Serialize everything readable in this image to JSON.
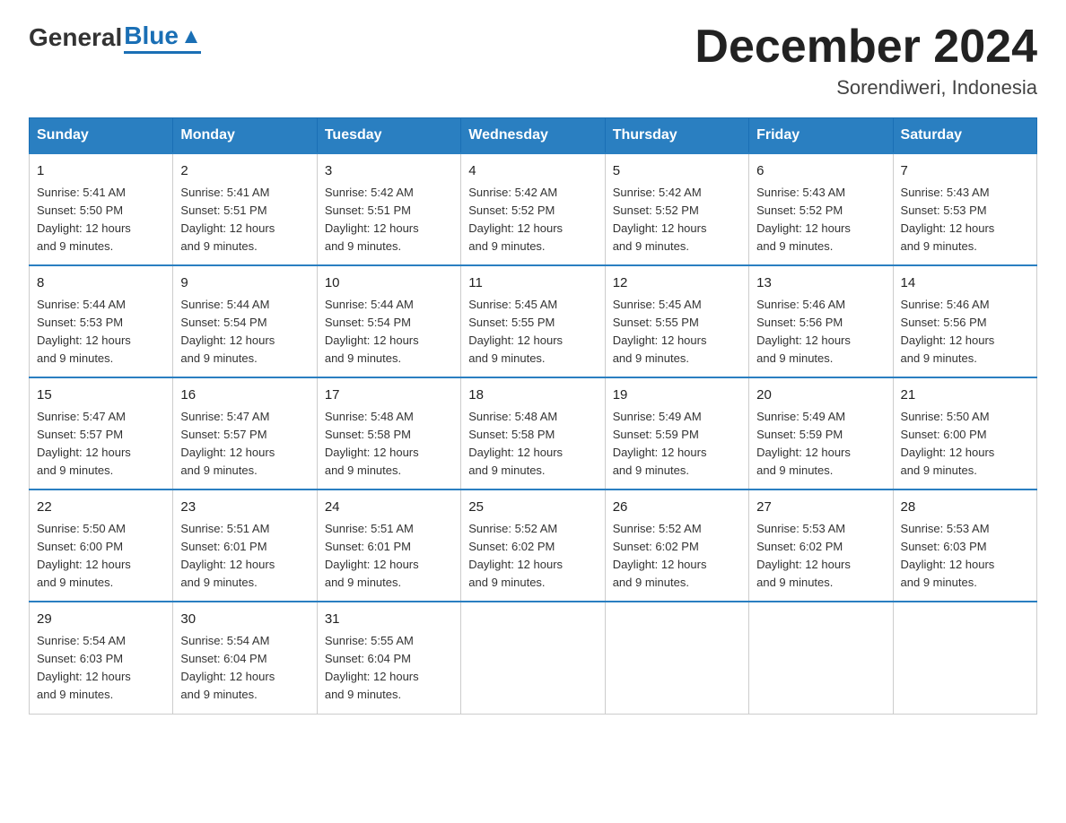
{
  "header": {
    "logo_general": "General",
    "logo_blue": "Blue",
    "month_title": "December 2024",
    "location": "Sorendiweri, Indonesia"
  },
  "days_of_week": [
    "Sunday",
    "Monday",
    "Tuesday",
    "Wednesday",
    "Thursday",
    "Friday",
    "Saturday"
  ],
  "weeks": [
    [
      {
        "day": "1",
        "sunrise": "5:41 AM",
        "sunset": "5:50 PM",
        "daylight": "12 hours and 9 minutes."
      },
      {
        "day": "2",
        "sunrise": "5:41 AM",
        "sunset": "5:51 PM",
        "daylight": "12 hours and 9 minutes."
      },
      {
        "day": "3",
        "sunrise": "5:42 AM",
        "sunset": "5:51 PM",
        "daylight": "12 hours and 9 minutes."
      },
      {
        "day": "4",
        "sunrise": "5:42 AM",
        "sunset": "5:52 PM",
        "daylight": "12 hours and 9 minutes."
      },
      {
        "day": "5",
        "sunrise": "5:42 AM",
        "sunset": "5:52 PM",
        "daylight": "12 hours and 9 minutes."
      },
      {
        "day": "6",
        "sunrise": "5:43 AM",
        "sunset": "5:52 PM",
        "daylight": "12 hours and 9 minutes."
      },
      {
        "day": "7",
        "sunrise": "5:43 AM",
        "sunset": "5:53 PM",
        "daylight": "12 hours and 9 minutes."
      }
    ],
    [
      {
        "day": "8",
        "sunrise": "5:44 AM",
        "sunset": "5:53 PM",
        "daylight": "12 hours and 9 minutes."
      },
      {
        "day": "9",
        "sunrise": "5:44 AM",
        "sunset": "5:54 PM",
        "daylight": "12 hours and 9 minutes."
      },
      {
        "day": "10",
        "sunrise": "5:44 AM",
        "sunset": "5:54 PM",
        "daylight": "12 hours and 9 minutes."
      },
      {
        "day": "11",
        "sunrise": "5:45 AM",
        "sunset": "5:55 PM",
        "daylight": "12 hours and 9 minutes."
      },
      {
        "day": "12",
        "sunrise": "5:45 AM",
        "sunset": "5:55 PM",
        "daylight": "12 hours and 9 minutes."
      },
      {
        "day": "13",
        "sunrise": "5:46 AM",
        "sunset": "5:56 PM",
        "daylight": "12 hours and 9 minutes."
      },
      {
        "day": "14",
        "sunrise": "5:46 AM",
        "sunset": "5:56 PM",
        "daylight": "12 hours and 9 minutes."
      }
    ],
    [
      {
        "day": "15",
        "sunrise": "5:47 AM",
        "sunset": "5:57 PM",
        "daylight": "12 hours and 9 minutes."
      },
      {
        "day": "16",
        "sunrise": "5:47 AM",
        "sunset": "5:57 PM",
        "daylight": "12 hours and 9 minutes."
      },
      {
        "day": "17",
        "sunrise": "5:48 AM",
        "sunset": "5:58 PM",
        "daylight": "12 hours and 9 minutes."
      },
      {
        "day": "18",
        "sunrise": "5:48 AM",
        "sunset": "5:58 PM",
        "daylight": "12 hours and 9 minutes."
      },
      {
        "day": "19",
        "sunrise": "5:49 AM",
        "sunset": "5:59 PM",
        "daylight": "12 hours and 9 minutes."
      },
      {
        "day": "20",
        "sunrise": "5:49 AM",
        "sunset": "5:59 PM",
        "daylight": "12 hours and 9 minutes."
      },
      {
        "day": "21",
        "sunrise": "5:50 AM",
        "sunset": "6:00 PM",
        "daylight": "12 hours and 9 minutes."
      }
    ],
    [
      {
        "day": "22",
        "sunrise": "5:50 AM",
        "sunset": "6:00 PM",
        "daylight": "12 hours and 9 minutes."
      },
      {
        "day": "23",
        "sunrise": "5:51 AM",
        "sunset": "6:01 PM",
        "daylight": "12 hours and 9 minutes."
      },
      {
        "day": "24",
        "sunrise": "5:51 AM",
        "sunset": "6:01 PM",
        "daylight": "12 hours and 9 minutes."
      },
      {
        "day": "25",
        "sunrise": "5:52 AM",
        "sunset": "6:02 PM",
        "daylight": "12 hours and 9 minutes."
      },
      {
        "day": "26",
        "sunrise": "5:52 AM",
        "sunset": "6:02 PM",
        "daylight": "12 hours and 9 minutes."
      },
      {
        "day": "27",
        "sunrise": "5:53 AM",
        "sunset": "6:02 PM",
        "daylight": "12 hours and 9 minutes."
      },
      {
        "day": "28",
        "sunrise": "5:53 AM",
        "sunset": "6:03 PM",
        "daylight": "12 hours and 9 minutes."
      }
    ],
    [
      {
        "day": "29",
        "sunrise": "5:54 AM",
        "sunset": "6:03 PM",
        "daylight": "12 hours and 9 minutes."
      },
      {
        "day": "30",
        "sunrise": "5:54 AM",
        "sunset": "6:04 PM",
        "daylight": "12 hours and 9 minutes."
      },
      {
        "day": "31",
        "sunrise": "5:55 AM",
        "sunset": "6:04 PM",
        "daylight": "12 hours and 9 minutes."
      },
      null,
      null,
      null,
      null
    ]
  ]
}
